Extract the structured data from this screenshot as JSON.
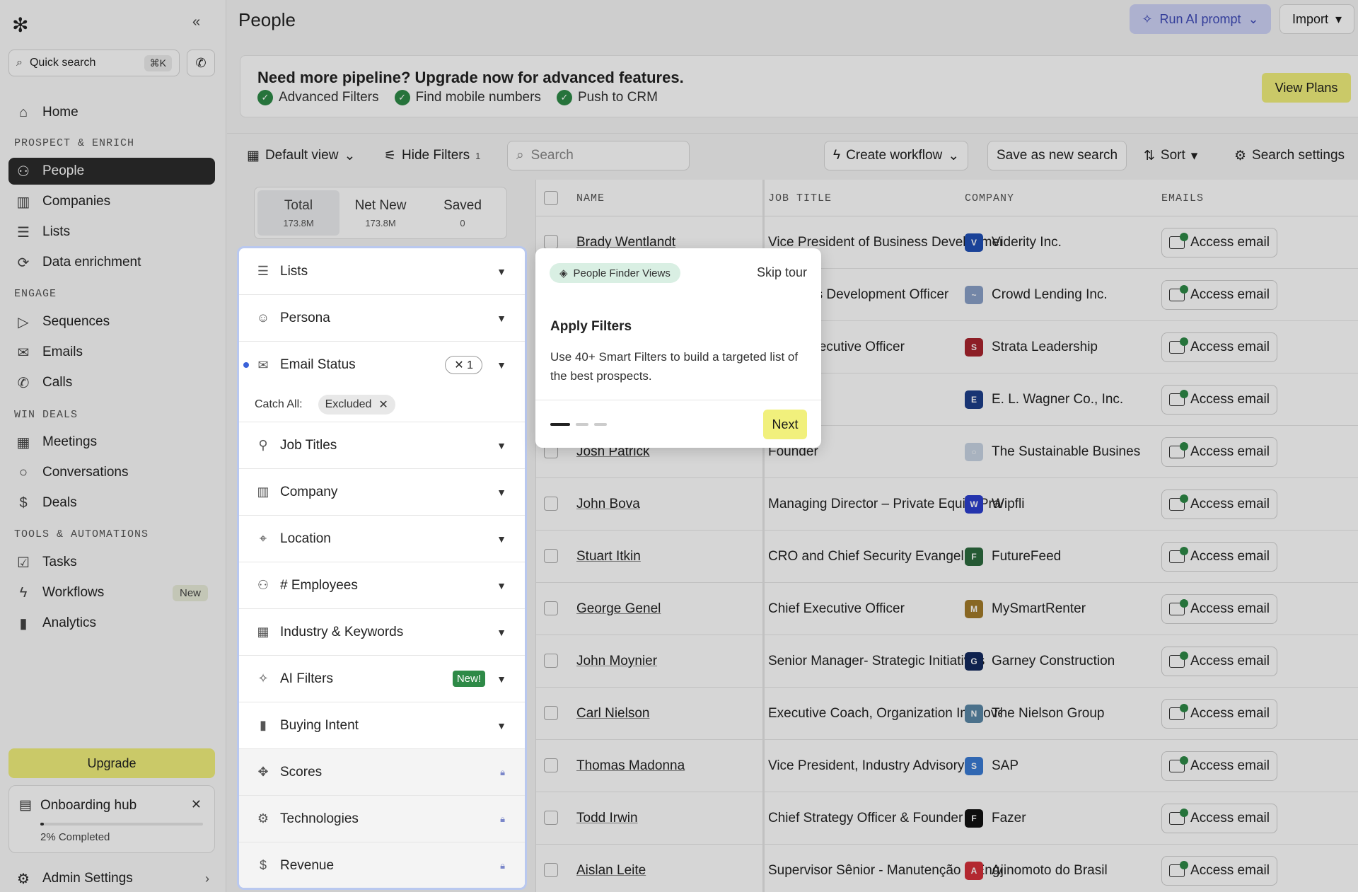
{
  "sidebar": {
    "quick_search": "Quick search",
    "quick_search_kbd": "⌘K",
    "home": "Home",
    "section_prospect": "PROSPECT & ENRICH",
    "people": "People",
    "companies": "Companies",
    "lists": "Lists",
    "data_enrichment": "Data enrichment",
    "section_engage": "ENGAGE",
    "sequences": "Sequences",
    "emails": "Emails",
    "calls": "Calls",
    "section_win": "WIN DEALS",
    "meetings": "Meetings",
    "conversations": "Conversations",
    "deals": "Deals",
    "section_tools": "TOOLS & AUTOMATIONS",
    "tasks": "Tasks",
    "workflows": "Workflows",
    "workflows_badge": "New",
    "analytics": "Analytics",
    "upgrade": "Upgrade",
    "onboarding_title": "Onboarding hub",
    "onboarding_progress": "2% Completed",
    "onboarding_fraction": 0.02,
    "admin_settings": "Admin Settings"
  },
  "header": {
    "title": "People",
    "run_ai": "Run AI prompt",
    "import": "Import"
  },
  "banner": {
    "headline": "Need more pipeline? Upgrade now for advanced features.",
    "features": [
      "Advanced Filters",
      "Find mobile numbers",
      "Push to CRM"
    ],
    "cta": "View Plans"
  },
  "toolbar": {
    "default_view": "Default view",
    "hide_filters": "Hide Filters",
    "hide_filters_count": "1",
    "search_placeholder": "Search",
    "create_workflow": "Create workflow",
    "save_search": "Save as new search",
    "sort": "Sort",
    "search_settings": "Search settings"
  },
  "tabs": [
    {
      "label": "Total",
      "count": "173.8M"
    },
    {
      "label": "Net New",
      "count": "173.8M"
    },
    {
      "label": "Saved",
      "count": "0"
    }
  ],
  "filters": {
    "lists": "Lists",
    "persona": "Persona",
    "email_status": "Email Status",
    "email_status_chip": "1",
    "catch_all_label": "Catch All:",
    "catch_all_value": "Excluded",
    "job_titles": "Job Titles",
    "company": "Company",
    "location": "Location",
    "employees": "# Employees",
    "industry": "Industry & Keywords",
    "ai_filters": "AI Filters",
    "ai_badge": "New!",
    "buying_intent": "Buying Intent",
    "scores": "Scores",
    "technologies": "Technologies",
    "revenue": "Revenue"
  },
  "table": {
    "headers": {
      "name": "NAME",
      "job_title": "JOB TITLE",
      "company": "COMPANY",
      "emails": "EMAILS"
    },
    "access_label": "Access email",
    "rows": [
      {
        "name": "Brady Wentlandt",
        "job": "Vice President of Business Developmer",
        "company": "Viderity Inc.",
        "logo_color": "#1f4fb5",
        "logo_text": "V"
      },
      {
        "name": "",
        "job": "Business Development Officer",
        "company": "Crowd Lending Inc.",
        "logo_color": "#8aa0c8",
        "logo_text": "~"
      },
      {
        "name": "",
        "job": "Chief Executive Officer",
        "company": "Strata Leadership",
        "logo_color": "#a8242e",
        "logo_text": "S"
      },
      {
        "name": "",
        "job": "",
        "company": "E. L. Wagner Co., Inc.",
        "logo_color": "#1d3e8a",
        "logo_text": "E"
      },
      {
        "name": "Josh Patrick",
        "job": "Founder",
        "company": "The Sustainable Busines",
        "logo_color": "#c9d5e4",
        "logo_text": "○"
      },
      {
        "name": "John Bova",
        "job": "Managing Director – Private Equity Prac",
        "company": "Wipfli",
        "logo_color": "#2b3fcf",
        "logo_text": "W"
      },
      {
        "name": "Stuart Itkin",
        "job": "CRO and Chief Security Evangelist",
        "company": "FutureFeed",
        "logo_color": "#2d6b3e",
        "logo_text": "F"
      },
      {
        "name": "George Genel",
        "job": "Chief Executive Officer",
        "company": "MySmartRenter",
        "logo_color": "#a37b2a",
        "logo_text": "M"
      },
      {
        "name": "John Moynier",
        "job": "Senior Manager- Strategic Initiatives",
        "company": "Garney Construction",
        "logo_color": "#12295e",
        "logo_text": "G"
      },
      {
        "name": "Carl Nielson",
        "job": "Executive Coach, Organization Improve",
        "company": "The Nielson Group",
        "logo_color": "#5a87a6",
        "logo_text": "N"
      },
      {
        "name": "Thomas Madonna",
        "job": "Vice President, Industry Advisory",
        "company": "SAP",
        "logo_color": "#3a7bd5",
        "logo_text": "S"
      },
      {
        "name": "Todd Irwin",
        "job": "Chief Strategy Officer & Founder",
        "company": "Fazer",
        "logo_color": "#111111",
        "logo_text": "F"
      },
      {
        "name": "Aislan Leite",
        "job": "Supervisor Sênior - Manutenção e Enge",
        "company": "Ajinomoto do Brasil",
        "logo_color": "#d6303a",
        "logo_text": "A"
      }
    ]
  },
  "tour": {
    "tag": "People Finder Views",
    "skip": "Skip tour",
    "title": "Apply Filters",
    "body": "Use 40+ Smart Filters to build a targeted list of the best prospects.",
    "next": "Next"
  }
}
